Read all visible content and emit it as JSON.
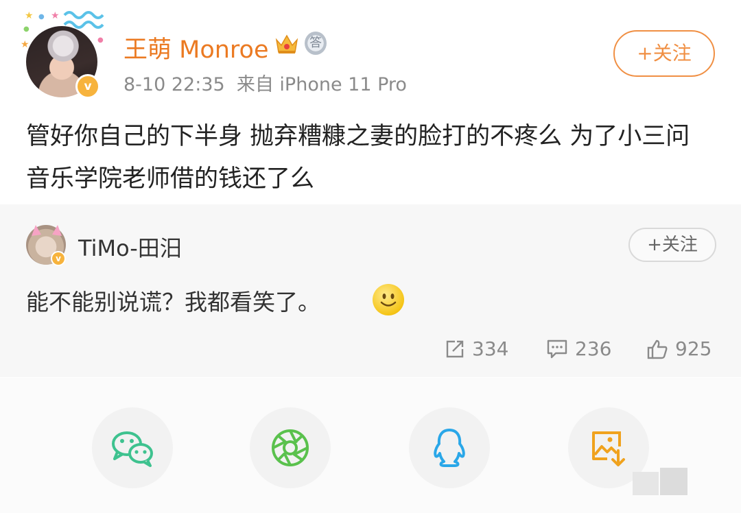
{
  "post": {
    "username": "王萌 Monroe",
    "timestamp": "8-10 22:35",
    "source": "来自 iPhone 11 Pro",
    "follow_label": "+关注",
    "medal_glyph": "答",
    "text": "管好你自己的下半身 抛弃糟糠之妻的脸打的不疼么 为了小三问音乐学院老师借的钱还了么",
    "verified_glyph": "v"
  },
  "retweet": {
    "username": "TiMo-田汨",
    "follow_label": "+关注",
    "text": "能不能别说谎？我都看笑了。",
    "verified_glyph": "v"
  },
  "stats": {
    "reposts": "334",
    "comments": "236",
    "likes": "925"
  },
  "share_targets": [
    "wechat-icon",
    "moments-icon",
    "qq-icon",
    "save-image-icon"
  ],
  "colors": {
    "username": "#eb7a22",
    "follow_border": "#f08f43",
    "verified": "#f7b33d",
    "wechat": "#3ec28f",
    "moments": "#5ac14d",
    "qq": "#2aa7e8",
    "save": "#f0a21d"
  }
}
